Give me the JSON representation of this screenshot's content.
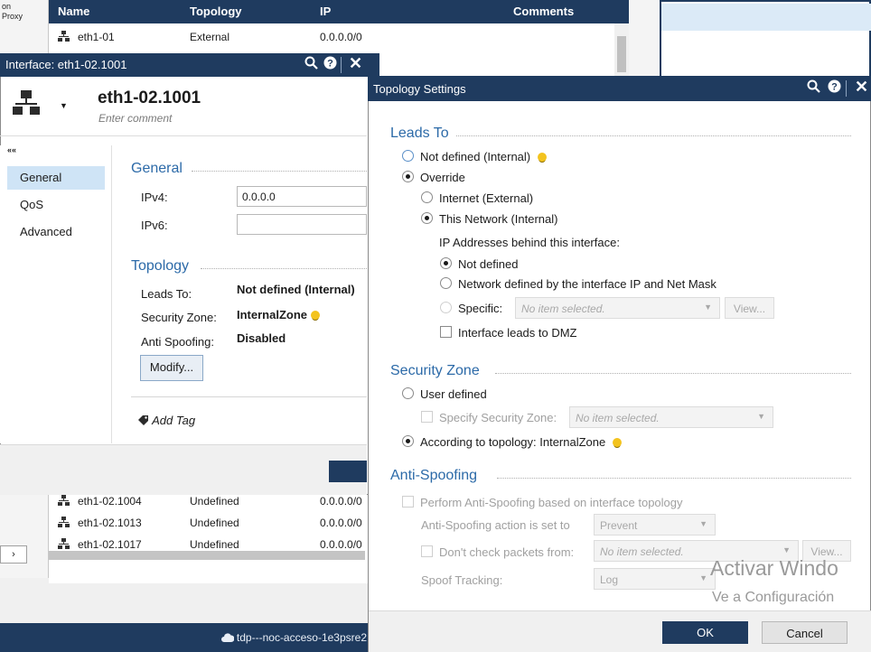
{
  "background_window": {
    "left_text": [
      "on",
      "Proxy"
    ],
    "left_arrow": "›",
    "columns": [
      "Name",
      "Topology",
      "IP",
      "Comments"
    ],
    "rows_top": [
      {
        "name": "eth1-01",
        "topology": "External",
        "ip": "0.0.0.0/0"
      }
    ],
    "rows_bottom": [
      {
        "name": "eth1-02.1004",
        "topology": "Undefined",
        "ip": "0.0.0.0/0"
      },
      {
        "name": "eth1-02.1013",
        "topology": "Undefined",
        "ip": "0.0.0.0/0"
      },
      {
        "name": "eth1-02.1017",
        "topology": "Undefined",
        "ip": "0.0.0.0/0"
      }
    ],
    "status_text": "tdp---noc-acceso-1e3psre2"
  },
  "interface_dialog": {
    "title": "Interface: eth1-02.1001",
    "name": "eth1-02.1001",
    "comment_placeholder": "Enter comment",
    "collapse": "««",
    "nav": [
      "General",
      "QoS",
      "Advanced"
    ],
    "general": {
      "section": "General",
      "ipv4_label": "IPv4:",
      "ipv4_value": "0.0.0.0",
      "ipv6_label": "IPv6:",
      "ipv6_value": ""
    },
    "topology": {
      "section": "Topology",
      "leads_label": "Leads To:",
      "leads_value": "Not defined (Internal)",
      "zone_label": "Security Zone:",
      "zone_value": "InternalZone",
      "spoof_label": "Anti Spoofing:",
      "spoof_value": "Disabled",
      "modify": "Modify..."
    },
    "add_tag": "Add Tag"
  },
  "topology_dialog": {
    "title": "Topology Settings",
    "leads_to": {
      "section": "Leads To",
      "not_defined": "Not defined (Internal)",
      "override": "Override",
      "internet": "Internet (External)",
      "this_network": "This Network (Internal)",
      "ip_behind": "IP Addresses behind this interface:",
      "ip_not_defined": "Not defined",
      "network_defined": "Network defined by the interface IP and Net Mask",
      "specific": "Specific:",
      "specific_select": "No item selected.",
      "view": "View...",
      "dmz": "Interface leads to DMZ"
    },
    "security_zone": {
      "section": "Security Zone",
      "user_defined": "User defined",
      "specify": "Specify Security Zone:",
      "specify_select": "No item selected.",
      "according": "According to topology: InternalZone"
    },
    "anti_spoofing": {
      "section": "Anti-Spoofing",
      "perform": "Perform Anti-Spoofing based on interface topology",
      "action_label": "Anti-Spoofing action is set to",
      "action_value": "Prevent",
      "dont_check": "Don't check packets from:",
      "dont_check_select": "No item selected.",
      "view": "View...",
      "tracking_label": "Spoof Tracking:",
      "tracking_value": "Log"
    },
    "ok": "OK",
    "cancel": "Cancel"
  },
  "watermark": {
    "line1": "Activar Windo",
    "line2": "Ve a Configuración"
  },
  "colors": {
    "titlebar": "#1f3b5f",
    "section_title": "#2c6aa8",
    "nav_active": "#cfe4f6",
    "bulb": "#f3c31e"
  }
}
